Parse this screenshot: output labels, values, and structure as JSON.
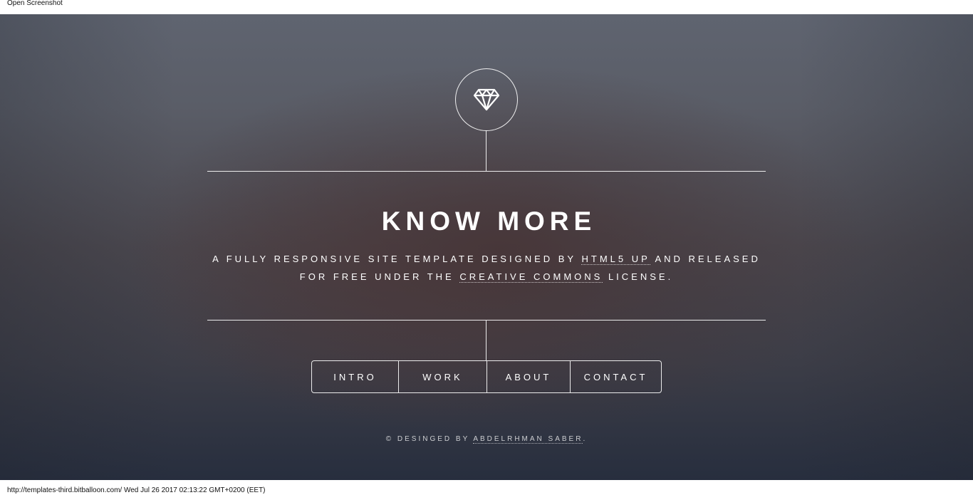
{
  "topbar": {
    "open_screenshot": "Open Screenshot"
  },
  "hero": {
    "icon": "diamond-icon",
    "title": "KNOW MORE",
    "description": {
      "part1": "A FULLY RESPONSIVE SITE TEMPLATE DESIGNED BY ",
      "link1": "HTML5 UP",
      "part2": " AND RELEASED FOR FREE UNDER THE ",
      "link2": "CREATIVE COMMONS",
      "part3": " LICENSE."
    }
  },
  "nav": {
    "items": [
      {
        "label": "INTRO"
      },
      {
        "label": "WORK"
      },
      {
        "label": "ABOUT"
      },
      {
        "label": "CONTACT"
      }
    ]
  },
  "footer": {
    "prefix": "© DESINGED BY ",
    "author": "ABDELRHMAN SABER",
    "suffix": "."
  },
  "status": {
    "text": "http://templates-third.bitballoon.com/ Wed Jul 26 2017 02:13:22 GMT+0200 (EET)"
  },
  "colors": {
    "accent": "#ffffff",
    "bg_top": "#5f6470",
    "bg_bottom": "#272e3e"
  }
}
